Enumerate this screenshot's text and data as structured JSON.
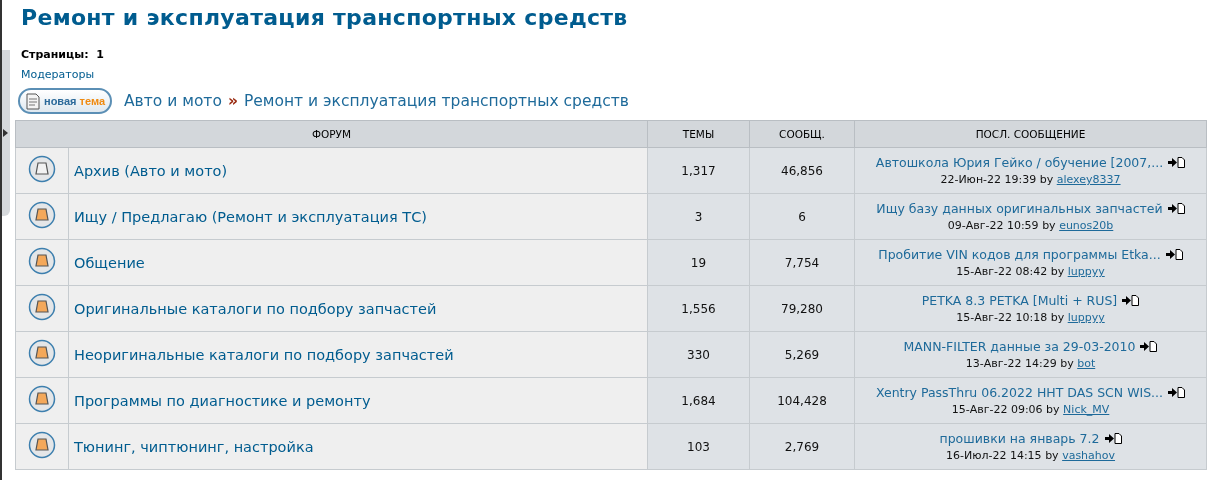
{
  "title": "Ремонт и эксплуатация транспортных средств",
  "pages": {
    "label": "Страницы:",
    "current": "1"
  },
  "moderators_link": "Модераторы",
  "new_topic_button": [
    "новая",
    "тема"
  ],
  "breadcrumb": {
    "items": [
      "Авто и мото",
      "Ремонт и эксплуатация транспортных средств"
    ],
    "separator": "»"
  },
  "table": {
    "columns": [
      "ФОРУМ",
      "ТЕМЫ",
      "СООБЩ.",
      "ПОСЛ. СООБЩЕНИЕ"
    ],
    "rows": [
      {
        "unread": false,
        "forum": "Архив (Авто и мото)",
        "topics": "1,317",
        "posts": "46,856",
        "last_title": "Автошкола Юрия Гейко / обучение [2007,...",
        "last_date": "22-Июн-22 19:39",
        "by": "by",
        "last_user": "alexey8337"
      },
      {
        "unread": true,
        "forum": "Ищу / Предлагаю (Ремонт и эксплуатация ТС)",
        "topics": "3",
        "posts": "6",
        "last_title": "Ищу базу данных оригинальных запчастей",
        "last_date": "09-Авг-22 10:59",
        "by": "by",
        "last_user": "eunos20b"
      },
      {
        "unread": true,
        "forum": "Общение",
        "topics": "19",
        "posts": "7,754",
        "last_title": "Пробитие VIN кодов для программы Etka...",
        "last_date": "15-Авг-22 08:42",
        "by": "by",
        "last_user": "luppyy"
      },
      {
        "unread": true,
        "forum": "Оригинальные каталоги по подбору запчастей",
        "topics": "1,556",
        "posts": "79,280",
        "last_title": "PETKA 8.3 PETKA [Multi + RUS]",
        "last_date": "15-Авг-22 10:18",
        "by": "by",
        "last_user": "luppyy"
      },
      {
        "unread": true,
        "forum": "Неоригинальные каталоги по подбору запчастей",
        "topics": "330",
        "posts": "5,269",
        "last_title": "MANN-FILTER данные за 29-03-2010",
        "last_date": "13-Авг-22 14:29",
        "by": "by",
        "last_user": "bot"
      },
      {
        "unread": true,
        "forum": "Программы по диагностике и ремонту",
        "topics": "1,684",
        "posts": "104,428",
        "last_title": "Xentry PassThru 06.2022 HHT DAS SCN WIS...",
        "last_date": "15-Авг-22 09:06",
        "by": "by",
        "last_user": "Nick_MV"
      },
      {
        "unread": true,
        "forum": "Тюнинг, чиптюнинг, настройка",
        "topics": "103",
        "posts": "2,769",
        "last_title": "прошивки на январь 7.2",
        "last_date": "16-Июл-22 14:15",
        "by": "by",
        "last_user": "vashahov"
      }
    ]
  }
}
